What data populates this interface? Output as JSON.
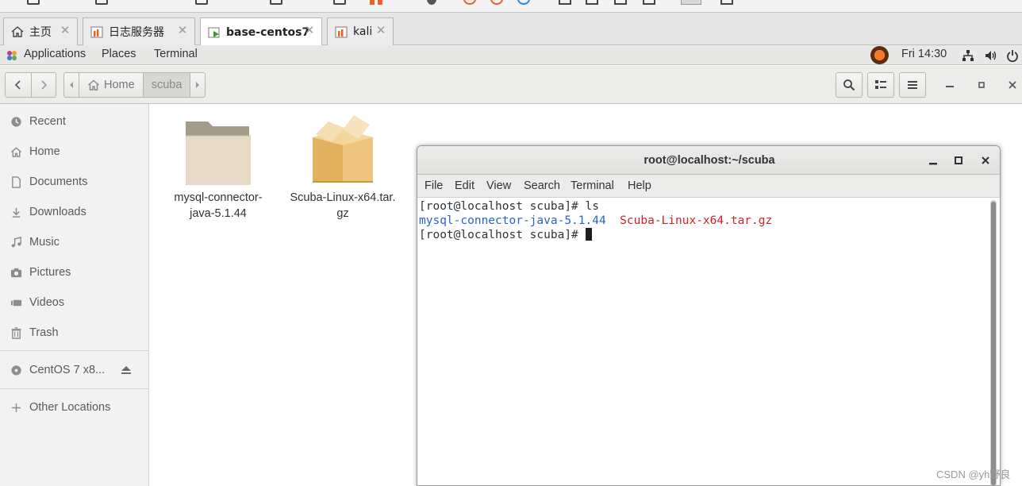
{
  "vm_tabs": [
    {
      "label": "主页",
      "icon": "home-icon",
      "active": false
    },
    {
      "label": "日志服务器",
      "icon": "vm-icon",
      "active": false
    },
    {
      "label": "base-centos7",
      "icon": "vm-running-icon",
      "active": true
    },
    {
      "label": "kali",
      "icon": "vm-icon",
      "active": false
    }
  ],
  "gnome_bar": {
    "applications": "Applications",
    "places": "Places",
    "terminal": "Terminal",
    "clock": "Fri 14:30"
  },
  "header": {
    "path": [
      "Home",
      "scuba"
    ]
  },
  "sidebar": {
    "items": [
      {
        "label": "Recent",
        "icon": "clock-icon"
      },
      {
        "label": "Home",
        "icon": "home-icon"
      },
      {
        "label": "Documents",
        "icon": "document-icon"
      },
      {
        "label": "Downloads",
        "icon": "download-icon"
      },
      {
        "label": "Music",
        "icon": "music-icon"
      },
      {
        "label": "Pictures",
        "icon": "camera-icon"
      },
      {
        "label": "Videos",
        "icon": "video-icon"
      },
      {
        "label": "Trash",
        "icon": "trash-icon"
      }
    ],
    "device": {
      "label": "CentOS 7 x8...",
      "icon": "disc-icon"
    },
    "other": {
      "label": "Other Locations",
      "icon": "plus-icon"
    }
  },
  "files": [
    {
      "line1": "mysql-connector-",
      "line2": "java-5.1.44",
      "type": "folder"
    },
    {
      "line1": "Scuba-Linux-x64.tar.",
      "line2": "gz",
      "type": "archive"
    }
  ],
  "terminal": {
    "title": "root@localhost:~/scuba",
    "menu": [
      "File",
      "Edit",
      "View",
      "Search",
      "Terminal",
      "Help"
    ],
    "lines": {
      "prompt1": "[root@localhost scuba]# ls",
      "dir_entry": "mysql-connector-java-5.1.44",
      "file_entry": "Scuba-Linux-x64.tar.gz",
      "prompt2": "[root@localhost scuba]# "
    },
    "colors": {
      "directory": "#2a62c9",
      "archive": "#d22222"
    }
  },
  "watermark": "CSDN @yh野良"
}
